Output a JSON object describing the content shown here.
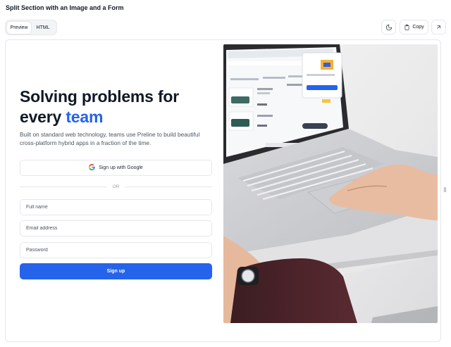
{
  "page": {
    "title": "Split Section with an Image and a Form"
  },
  "view_toggle": {
    "preview": "Preview",
    "html": "HTML",
    "selected": "Preview"
  },
  "toolbar": {
    "copy_label": "Copy",
    "icons": [
      "moon-icon",
      "clipboard-icon",
      "arrow-up-right-icon"
    ]
  },
  "hero": {
    "title_line1": "Solving problems for",
    "title_prefix": "every ",
    "title_accent": "team",
    "subtitle": "Built on standard web technology, teams use Preline to build beautiful cross-platform hybrid apps in a fraction of the time."
  },
  "form": {
    "google_label": "Sign up with Google",
    "divider_label": "OR",
    "fullname_placeholder": "Full name",
    "email_placeholder": "Email address",
    "password_placeholder": "Password",
    "submit_label": "Sign up"
  },
  "colors": {
    "accent": "#2563eb",
    "heading": "#111827",
    "border": "#e5e7eb"
  }
}
